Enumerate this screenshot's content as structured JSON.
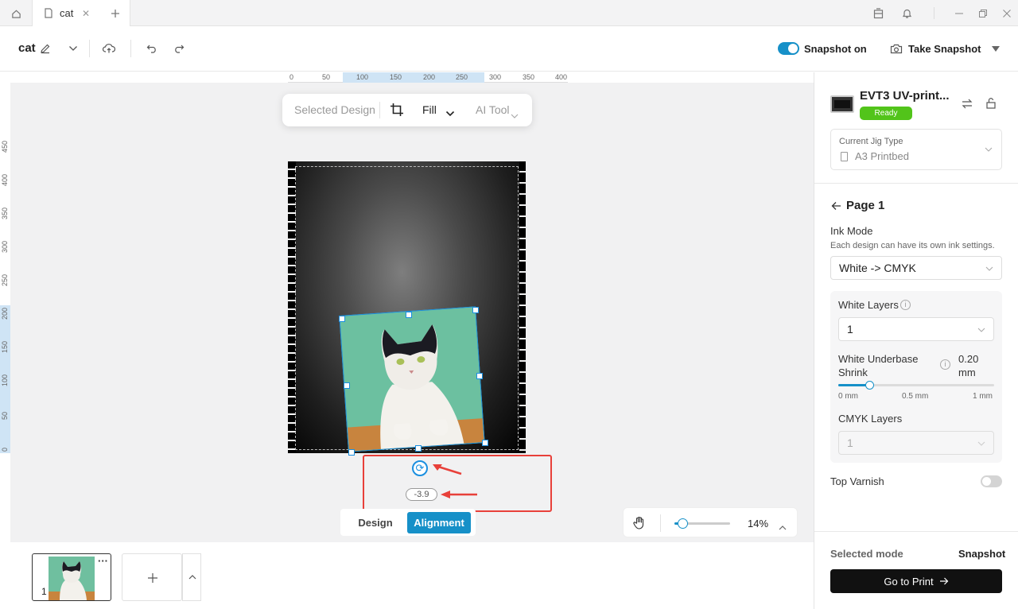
{
  "tabbar": {
    "tab_label": "cat"
  },
  "toolbar": {
    "title": "cat",
    "snapshot_toggle_label": "Snapshot on",
    "take_snapshot_label": "Take Snapshot"
  },
  "ruler": {
    "h": [
      "0",
      "50",
      "100",
      "150",
      "200",
      "250",
      "300",
      "350",
      "400"
    ],
    "v": [
      "450",
      "400",
      "350",
      "300",
      "250",
      "200",
      "150",
      "100",
      "50",
      "0"
    ]
  },
  "floating_toolbar": {
    "selected_design": "Selected Design",
    "fill": "Fill",
    "ai_tool": "AI Tool"
  },
  "rotation": {
    "angle": "-3.9"
  },
  "mode_tabs": {
    "design": "Design",
    "alignment": "Alignment"
  },
  "zoom": {
    "value": "14%",
    "level": 0.14
  },
  "thumbnails": {
    "page_number": "1"
  },
  "device": {
    "name": "EVT3 UV-print...",
    "status": "Ready"
  },
  "jig": {
    "label": "Current Jig Type",
    "value": "A3 Printbed"
  },
  "page": {
    "title": "Page 1"
  },
  "ink": {
    "label": "Ink Mode",
    "desc": "Each design can have its own ink settings.",
    "value": "White -> CMYK"
  },
  "white_layers": {
    "label": "White Layers",
    "value": "1"
  },
  "shrink": {
    "label": "White Underbase Shrink",
    "value": "0.20 mm",
    "min": "0 mm",
    "mid": "0.5 mm",
    "max": "1 mm",
    "level": 0.2
  },
  "cmyk": {
    "label": "CMYK Layers",
    "value": "1"
  },
  "varnish": {
    "label": "Top Varnish"
  },
  "footer": {
    "selected_mode_label": "Selected mode",
    "selected_mode_value": "Snapshot",
    "go_to_print": "Go to Print"
  },
  "colors": {
    "accent": "#1690c8",
    "ready": "#52c41a",
    "annotation": "#e8403a"
  }
}
